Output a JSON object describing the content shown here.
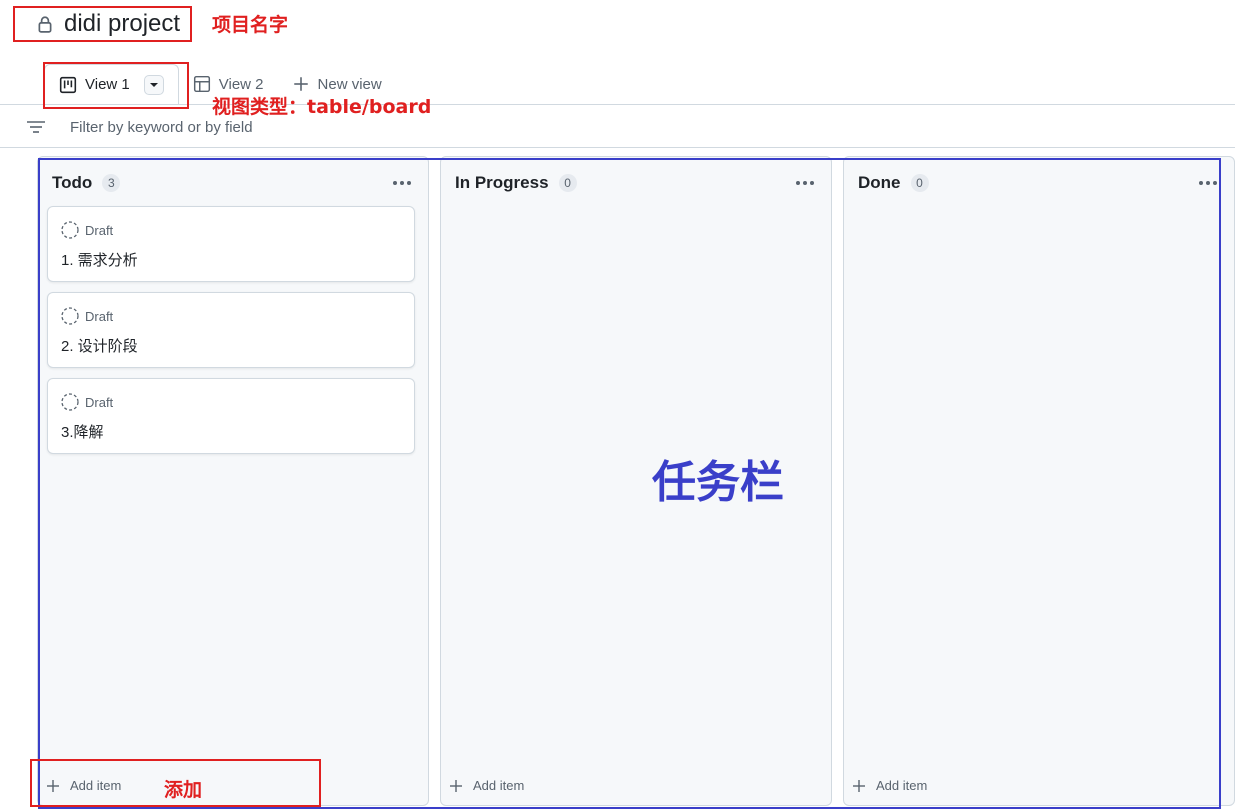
{
  "project": {
    "title": "didi project",
    "lock_icon": "lock-icon"
  },
  "views": [
    {
      "label": "View 1",
      "icon": "board-icon",
      "active": true
    },
    {
      "label": "View 2",
      "icon": "table-icon",
      "active": false
    },
    {
      "label": "New view",
      "icon": "plus-icon",
      "active": false
    }
  ],
  "filter": {
    "placeholder": "Filter by keyword or by field",
    "value": ""
  },
  "columns": [
    {
      "title": "Todo",
      "count": "3",
      "cards": [
        {
          "status": "Draft",
          "title": "1. 需求分析"
        },
        {
          "status": "Draft",
          "title": "2. 设计阶段"
        },
        {
          "status": "Draft",
          "title": "3.降解"
        }
      ],
      "add_label": "Add item"
    },
    {
      "title": "In Progress",
      "count": "0",
      "cards": [],
      "add_label": "Add item"
    },
    {
      "title": "Done",
      "count": "0",
      "cards": [],
      "add_label": "Add item"
    }
  ],
  "annotations": {
    "project_name": "项目名字",
    "view_type": "视图类型：table/board",
    "task_columns": "任务栏",
    "add": "添加",
    "red": "#e02020",
    "blue": "#3a3fc9"
  }
}
